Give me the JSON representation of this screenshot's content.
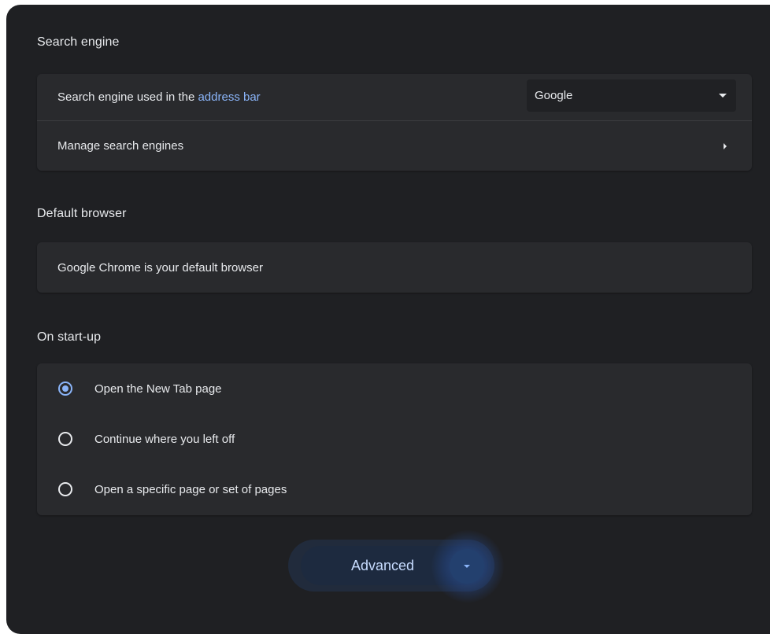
{
  "search_engine": {
    "title": "Search engine",
    "used_in_prefix": "Search engine used in the ",
    "used_in_link": "address bar",
    "selected_engine": "Google",
    "manage_label": "Manage search engines"
  },
  "default_browser": {
    "title": "Default browser",
    "status": "Google Chrome is your default browser"
  },
  "startup": {
    "title": "On start-up",
    "options": [
      {
        "label": "Open the New Tab page",
        "checked": true
      },
      {
        "label": "Continue where you left off",
        "checked": false
      },
      {
        "label": "Open a specific page or set of pages",
        "checked": false
      }
    ]
  },
  "advanced": {
    "label": "Advanced",
    "icon": "chevron-down-icon"
  },
  "colors": {
    "accent": "#8ab4f8",
    "background": "#1f2023",
    "card": "#292a2d"
  }
}
